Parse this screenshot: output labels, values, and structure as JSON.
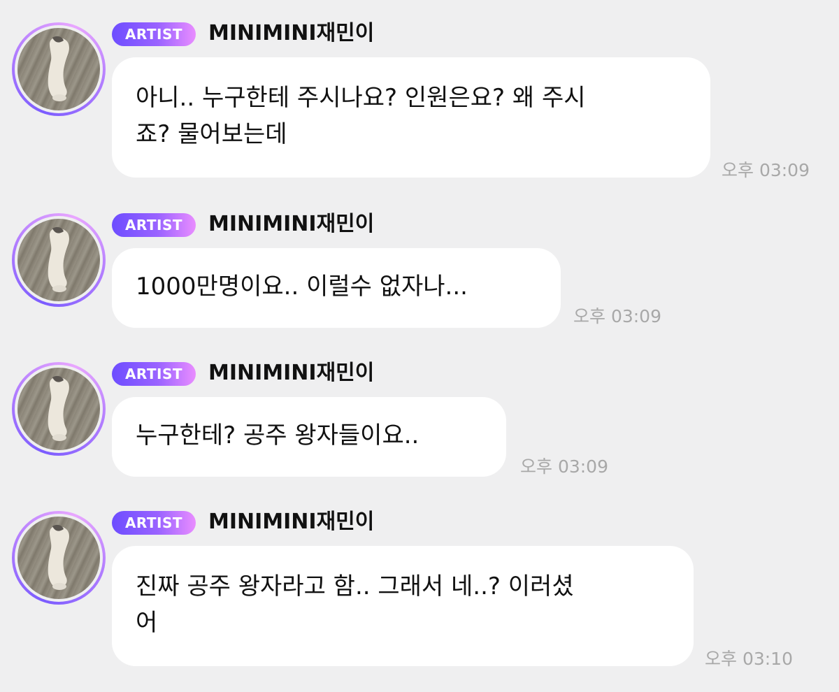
{
  "messages": [
    {
      "badge": "ARTIST",
      "sender": "MINIMINI재민이",
      "text": "아니.. 누구한테 주시나요? 인원은요? 왜 주시\n죠? 물어보는데",
      "time": "오후 03:09"
    },
    {
      "badge": "ARTIST",
      "sender": "MINIMINI재민이",
      "text": "1000만명이요.. 이럴수 없자나...",
      "time": "오후 03:09"
    },
    {
      "badge": "ARTIST",
      "sender": "MINIMINI재민이",
      "text": "누구한테? 공주 왕자들이요..",
      "time": "오후 03:09"
    },
    {
      "badge": "ARTIST",
      "sender": "MINIMINI재민이",
      "text": "진짜 공주 왕자라고 함.. 그래서 네..? 이러셨\n어",
      "time": "오후 03:10"
    }
  ],
  "avatar_icon": "cat-photo-avatar",
  "colors": {
    "background": "#efeff0",
    "bubble": "#ffffff",
    "badge_start": "#6d4dff",
    "badge_end": "#e98dff",
    "timestamp": "#a8a8a8"
  }
}
